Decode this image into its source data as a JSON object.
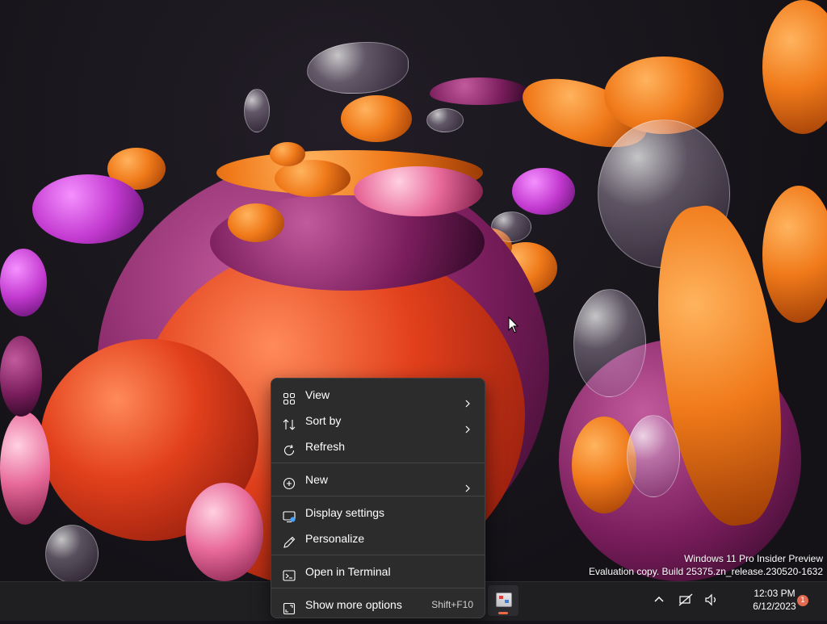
{
  "wallpaper": {
    "background_color": "#17151b",
    "accent_colors": [
      "#e2401c",
      "#f07a1a",
      "#c33ad0",
      "#7a1d5c"
    ]
  },
  "watermark": {
    "line1": "Windows 11 Pro Insider Preview",
    "line2": "Evaluation copy. Build 25375.zn_release.230520-1632"
  },
  "context_menu": {
    "items": [
      {
        "label": "View",
        "icon": "grid-view-icon",
        "has_submenu": true
      },
      {
        "label": "Sort by",
        "icon": "sort-arrows-icon",
        "has_submenu": true
      },
      {
        "label": "Refresh",
        "icon": "refresh-icon",
        "has_submenu": false
      },
      {
        "label": "New",
        "icon": "plus-circle-icon",
        "has_submenu": true
      },
      {
        "label": "Display settings",
        "icon": "display-icon",
        "has_submenu": false
      },
      {
        "label": "Personalize",
        "icon": "pen-icon",
        "has_submenu": false
      },
      {
        "label": "Open in Terminal",
        "icon": "terminal-icon",
        "has_submenu": false
      },
      {
        "label": "Show more options",
        "icon": "expand-icon",
        "shortcut": "Shift+F10"
      }
    ]
  },
  "taskbar": {
    "background_color": "#1f1f22",
    "pinned_app": {
      "icon": "desktop-app-icon",
      "active_indicator_color": "#f06a4a"
    },
    "tray": {
      "chevron_icon": "chevron-up-icon",
      "icons": [
        "network-icon",
        "volume-icon"
      ],
      "time": "12:03 PM",
      "date": "6/12/2023",
      "notification_badge": "1"
    }
  }
}
